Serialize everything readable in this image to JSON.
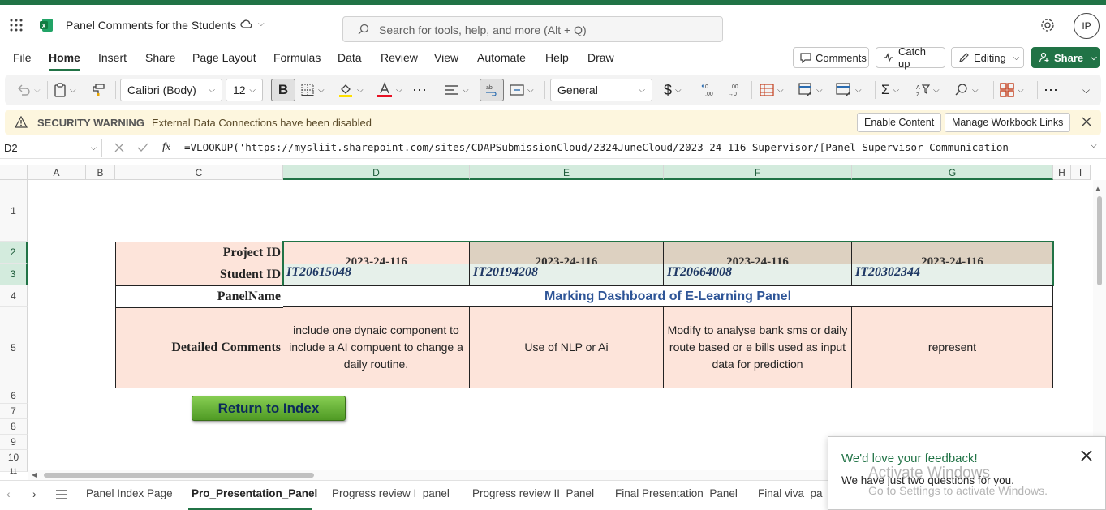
{
  "window": {
    "title": "Panel Comments for the Students",
    "avatar_initials": "IP"
  },
  "search": {
    "placeholder": "Search for tools, help, and more (Alt + Q)"
  },
  "menu": {
    "items": [
      "File",
      "Home",
      "Insert",
      "Share",
      "Page Layout",
      "Formulas",
      "Data",
      "Review",
      "View",
      "Automate",
      "Help",
      "Draw"
    ],
    "active": "Home",
    "comments_label": "Comments",
    "catchup_label": "Catch up",
    "editing_label": "Editing",
    "share_label": "Share"
  },
  "ribbon": {
    "font_name": "Calibri (Body)",
    "font_size": "12",
    "number_format": "General",
    "currency_symbol": "$"
  },
  "security": {
    "title": "SECURITY WARNING",
    "message": "External Data Connections have been disabled",
    "enable_label": "Enable Content",
    "manage_label": "Manage Workbook Links"
  },
  "formula_bar": {
    "name_box": "D2",
    "fx": "fx",
    "formula": "=VLOOKUP('https://mysliit.sharepoint.com/sites/CDAPSubmissionCloud/2324JuneCloud/2023-24-116-Supervisor/[Panel-Supervisor Communication"
  },
  "grid": {
    "columns": [
      "A",
      "B",
      "C",
      "D",
      "E",
      "F",
      "G",
      "H",
      "I"
    ],
    "rows": [
      "1",
      "2",
      "3",
      "4",
      "5",
      "6",
      "7",
      "8",
      "9",
      "10",
      "11"
    ],
    "labels": {
      "project_id": "Project ID",
      "student_id": "Student ID",
      "panel_name": "PanelName",
      "detailed_comments": "Detailed Comments"
    },
    "project_ids": [
      "2023-24-116",
      "2023-24-116",
      "2023-24-116",
      "2023-24-116"
    ],
    "student_ids": [
      "IT20615048",
      "IT20194208",
      "IT20664008",
      "IT20302344"
    ],
    "panel_title": "Marking Dashboard of E-Learning Panel",
    "comments": [
      "include one dynaic component to include a AI compuent to change a daily routine.",
      "Use of NLP or Ai",
      "Modify to analyse bank sms or daily route based or e bills used as input data for prediction",
      "represent"
    ],
    "return_button": "Return to Index"
  },
  "sheet_tabs": {
    "items": [
      "Panel Index Page",
      "Pro_Presentation_Panel",
      "Progress review I_panel",
      "Progress review II_Panel",
      "Final Presentation_Panel",
      "Final viva_pa"
    ],
    "active": "Pro_Presentation_Panel"
  },
  "feedback": {
    "title": "We'd love your feedback!",
    "text": "We have just two questions for you."
  },
  "watermark": {
    "line1": "Activate Windows",
    "line2": "Go to Settings to activate Windows."
  },
  "colors": {
    "accent": "#217346",
    "peach": "#fde4da",
    "tan": "#ddd1c1",
    "panel_title": "#2e5597",
    "student_id": "#1f3864",
    "button_green": "#5aa82e"
  }
}
